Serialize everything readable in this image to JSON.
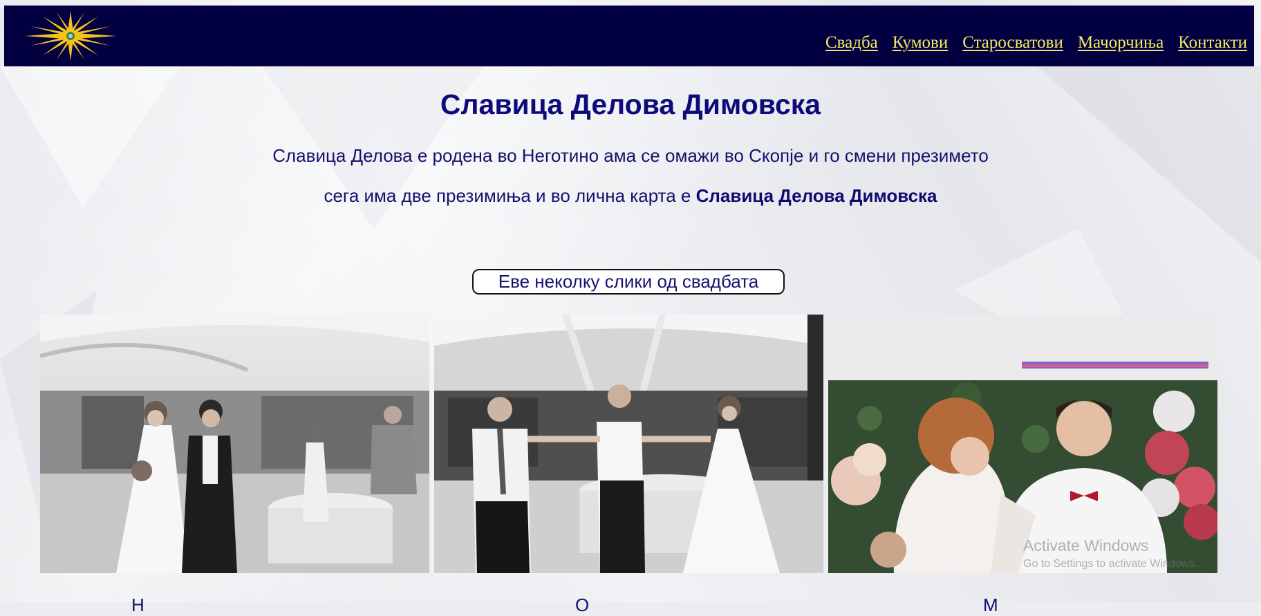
{
  "nav": {
    "logo_icon": "vergina-sun-logo",
    "links": [
      "Свадба",
      "Кумови",
      "Старосватови",
      "Мачорчиња",
      "Контакти"
    ]
  },
  "main": {
    "title": "Славица Делова Димовска",
    "paragraph1": "Славица Делова е родена во Неготино ама се омажи во Скопје и го смени презимето",
    "paragraph2_prefix": "сега има две презимиња и во лична карта е ",
    "paragraph2_strong": "Славица Делова Димовска",
    "gallery_button": "Еве неколку слики од свадбата"
  },
  "gallery": {
    "photos": [
      "bride-groom-walking-photo",
      "dance-circle-photo",
      "couple-table-photo"
    ],
    "captions": [
      "Н",
      "О",
      "М"
    ]
  },
  "watermark": {
    "line1": "Activate Windows",
    "line2": "Go to Settings to activate Windows."
  },
  "colors": {
    "navbar": "#020040",
    "nav_link": "#f3ea5f",
    "heading": "#0d0b7a"
  }
}
